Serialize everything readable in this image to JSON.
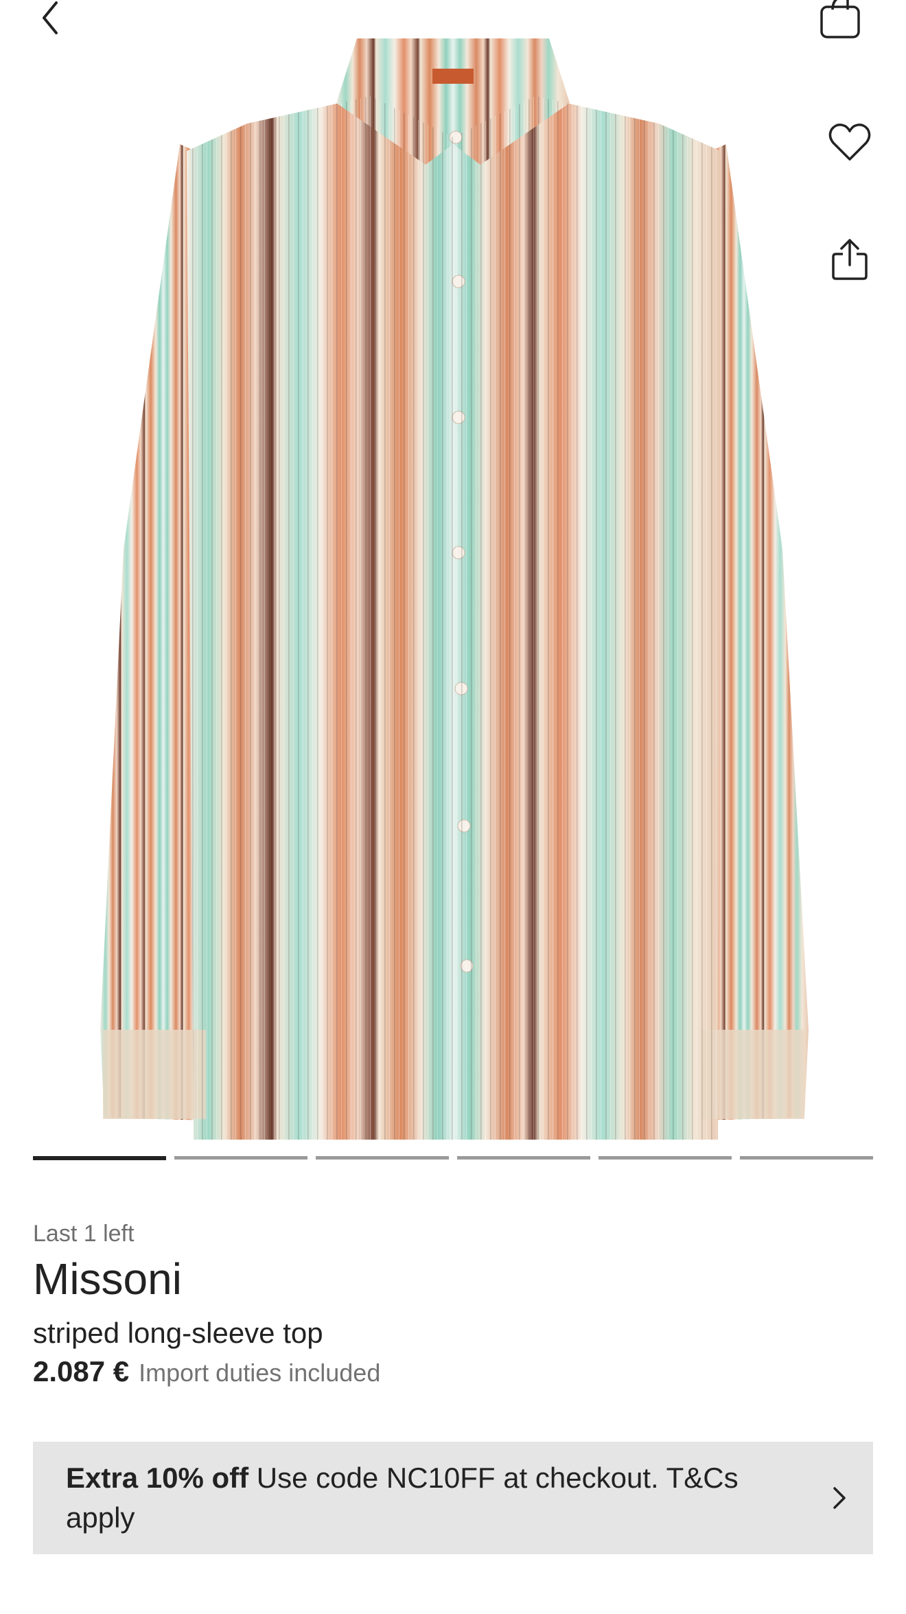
{
  "nav": {
    "back_icon": "chevron-left-icon",
    "bag_icon": "shopping-bag-icon",
    "favorite_icon": "heart-icon",
    "share_icon": "share-icon"
  },
  "gallery": {
    "image_subject": "striped long-sleeve shirt",
    "slide_count": 6,
    "active_slide": 1
  },
  "product": {
    "stock_status": "Last 1 left",
    "brand": "Missoni",
    "name": "striped long-sleeve top",
    "price": "2.087 €",
    "duties_note": "Import duties included"
  },
  "promo": {
    "bold": "Extra 10% off",
    "text": " Use code NC10FF at checkout. T&Cs apply",
    "chevron_icon": "chevron-right-icon"
  },
  "colors": {
    "text": "#222222",
    "muted": "#6f6f6f",
    "promo_bg": "#e5e5e5",
    "stripe_orange": "#d98a63",
    "stripe_mint": "#9fd8c6",
    "stripe_cream": "#f2e6d6",
    "stripe_brown": "#6b3a2c"
  }
}
